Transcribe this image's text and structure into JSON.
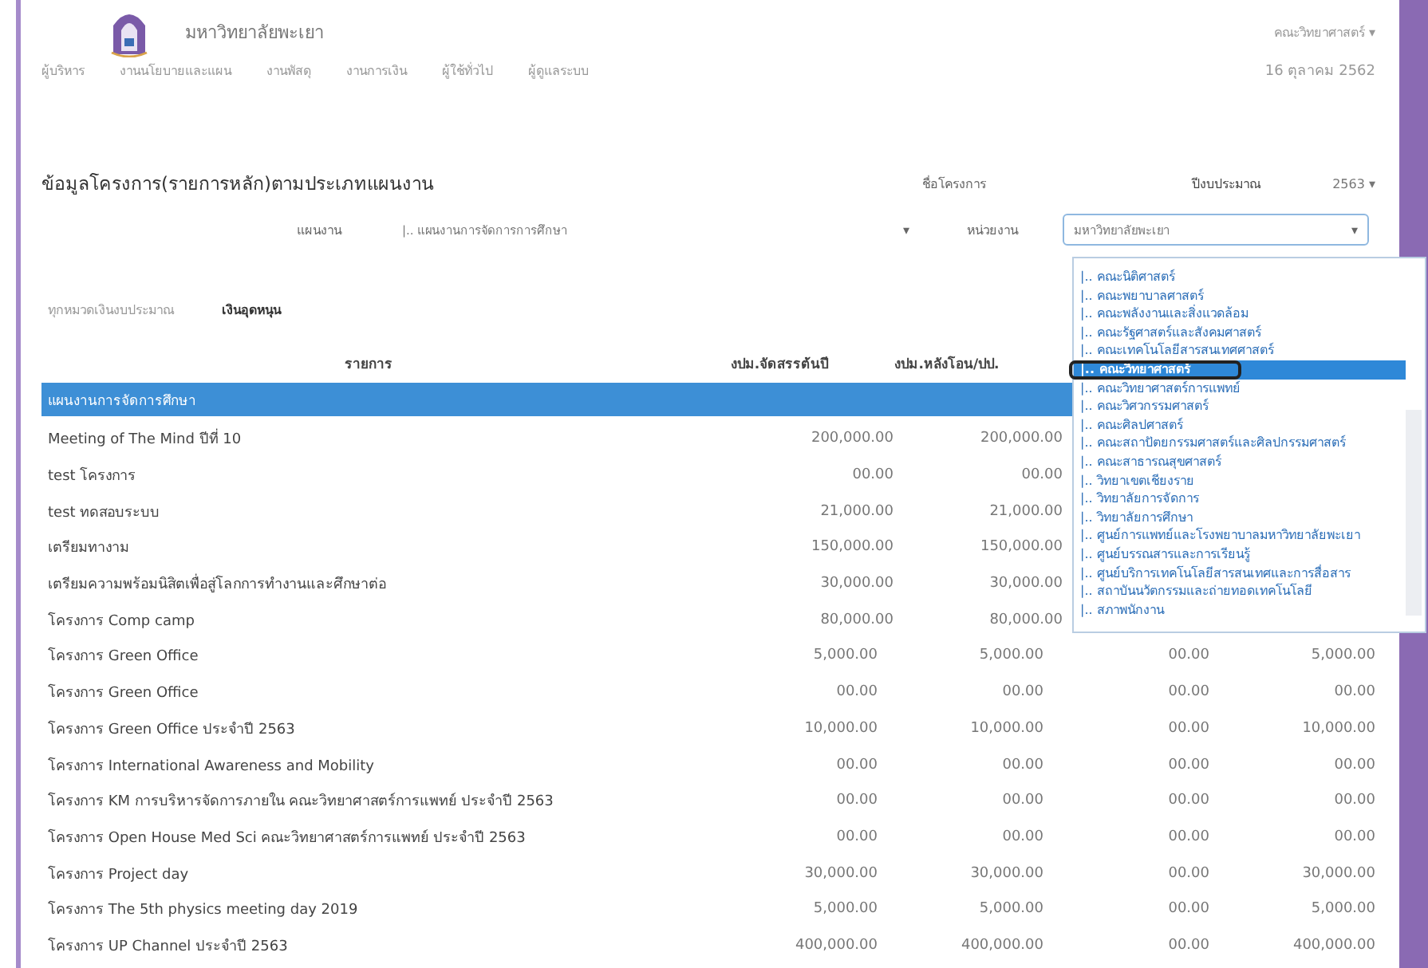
{
  "header": {
    "brand": "มหาวิทยาลัยพะเยา",
    "user_menu": "คณะวิทยาศาสตร์ ▾"
  },
  "nav": {
    "items": [
      "ผู้บริหาร",
      "งานนโยบายและแผน",
      "งานพัสดุ",
      "งานการเงิน",
      "ผู้ใช้ทั่วไป",
      "ผู้ดูแลระบบ"
    ],
    "date": "16 ตุลาคม 2562"
  },
  "page_title": "ข้อมูลโครงการ(รายการหลัก)ตามประเภทแผนงาน",
  "filters": {
    "project_label": "ชื่อโครงการ",
    "year_label": "ปีงบประมาณ",
    "year_value": "2563 ▾",
    "plan_label": "แผนงาน",
    "plan_value": "|.. แผนงานการจัดการการศึกษา",
    "plan_caret": "▾",
    "unit_label": "หน่วยงาน",
    "unit_value": "มหาวิทยาลัยพะเยา",
    "unit_caret": "▾"
  },
  "tabs": [
    {
      "label": "ทุกหมวดเงินงบประมาณ",
      "selected": false
    },
    {
      "label": "เงินอุดหนุน",
      "selected": true
    }
  ],
  "table": {
    "columns": [
      "รายการ",
      "งปม.จัดสรรต้นปี",
      "งปม.หลังโอน/ปป."
    ],
    "rows": [
      {
        "kind": "group",
        "label": "แผนงานการจัดการศึกษา"
      },
      {
        "kind": "item",
        "label": "Meeting of The Mind ปีที่ 10",
        "values": [
          "200,000.00",
          "200,000.00"
        ]
      },
      {
        "kind": "item",
        "label": "test โครงการ",
        "values": [
          "00.00",
          "00.00"
        ]
      },
      {
        "kind": "item",
        "label": "test ทดสอบระบบ",
        "values": [
          "21,000.00",
          "21,000.00"
        ]
      },
      {
        "kind": "item",
        "label": "เตรียมทางาม",
        "values": [
          "150,000.00",
          "150,000.00"
        ]
      },
      {
        "kind": "item",
        "label": "เตรียมความพร้อมนิสิตเพื่อสู่โลกการทำงานและศึกษาต่อ",
        "values": [
          "30,000.00",
          "30,000.00"
        ]
      },
      {
        "kind": "item",
        "label": "โครงการ Comp camp",
        "values": [
          "80,000.00",
          "80,000.00"
        ]
      },
      {
        "kind": "item",
        "label": "โครงการ Green Office",
        "values": [
          "5,000.00",
          "5,000.00",
          "00.00",
          "5,000.00"
        ]
      },
      {
        "kind": "item",
        "label": "โครงการ Green Office",
        "values": [
          "00.00",
          "00.00",
          "00.00",
          "00.00"
        ]
      },
      {
        "kind": "item",
        "label": "โครงการ Green Office ประจำปี 2563",
        "values": [
          "10,000.00",
          "10,000.00",
          "00.00",
          "10,000.00"
        ]
      },
      {
        "kind": "item",
        "label": "โครงการ International Awareness and Mobility",
        "values": [
          "00.00",
          "00.00",
          "00.00",
          "00.00"
        ]
      },
      {
        "kind": "item",
        "label": "โครงการ KM การบริหารจัดการภายใน คณะวิทยาศาสตร์การแพทย์ ประจำปี 2563",
        "values": [
          "00.00",
          "00.00",
          "00.00",
          "00.00"
        ]
      },
      {
        "kind": "item",
        "label": "โครงการ Open House Med Sci คณะวิทยาศาสตร์การแพทย์ ประจำปี 2563",
        "values": [
          "00.00",
          "00.00",
          "00.00",
          "00.00"
        ]
      },
      {
        "kind": "item",
        "label": "โครงการ Project day",
        "values": [
          "30,000.00",
          "30,000.00",
          "00.00",
          "30,000.00"
        ]
      },
      {
        "kind": "item",
        "label": "โครงการ The 5th physics meeting day 2019",
        "values": [
          "5,000.00",
          "5,000.00",
          "00.00",
          "5,000.00"
        ]
      },
      {
        "kind": "item",
        "label": "โครงการ UP Channel ประจำปี 2563",
        "values": [
          "400,000.00",
          "400,000.00",
          "00.00",
          "400,000.00"
        ]
      }
    ]
  },
  "unit_dropdown": {
    "options": [
      {
        "label": "|.. คณะนิติศาสตร์",
        "selected": false
      },
      {
        "label": "|.. คณะพยาบาลศาสตร์",
        "selected": false
      },
      {
        "label": "|.. คณะพลังงานและสิ่งแวดล้อม",
        "selected": false
      },
      {
        "label": "|.. คณะรัฐศาสตร์และสังคมศาสตร์",
        "selected": false
      },
      {
        "label": "|.. คณะเทคโนโลยีสารสนเทศศาสตร์",
        "selected": false
      },
      {
        "label": "|.. คณะวิทยาศาสตร์",
        "selected": true
      },
      {
        "label": "|.. คณะวิทยาศาสตร์การแพทย์",
        "selected": false
      },
      {
        "label": "|.. คณะวิศวกรรมศาสตร์",
        "selected": false
      },
      {
        "label": "|.. คณะศิลปศาสตร์",
        "selected": false
      },
      {
        "label": "|.. คณะสถาปัตยกรรมศาสตร์และศิลปกรรมศาสตร์",
        "selected": false
      },
      {
        "label": "|.. คณะสาธารณสุขศาสตร์",
        "selected": false
      },
      {
        "label": "|.. วิทยาเขตเชียงราย",
        "selected": false
      },
      {
        "label": "|.. วิทยาลัยการจัดการ",
        "selected": false
      },
      {
        "label": "|.. วิทยาลัยการศึกษา",
        "selected": false
      },
      {
        "label": "|.. ศูนย์การแพทย์และโรงพยาบาลมหาวิทยาลัยพะเยา",
        "selected": false
      },
      {
        "label": "|.. ศูนย์บรรณสารและการเรียนรู้",
        "selected": false
      },
      {
        "label": "|.. ศูนย์บริการเทคโนโลยีสารสนเทศและการสื่อสาร",
        "selected": false
      },
      {
        "label": "|.. สถาบันนวัตกรรมและถ่ายทอดเทคโนโลยี",
        "selected": false
      },
      {
        "label": "|.. สภาพนักงาน",
        "selected": false
      }
    ]
  }
}
